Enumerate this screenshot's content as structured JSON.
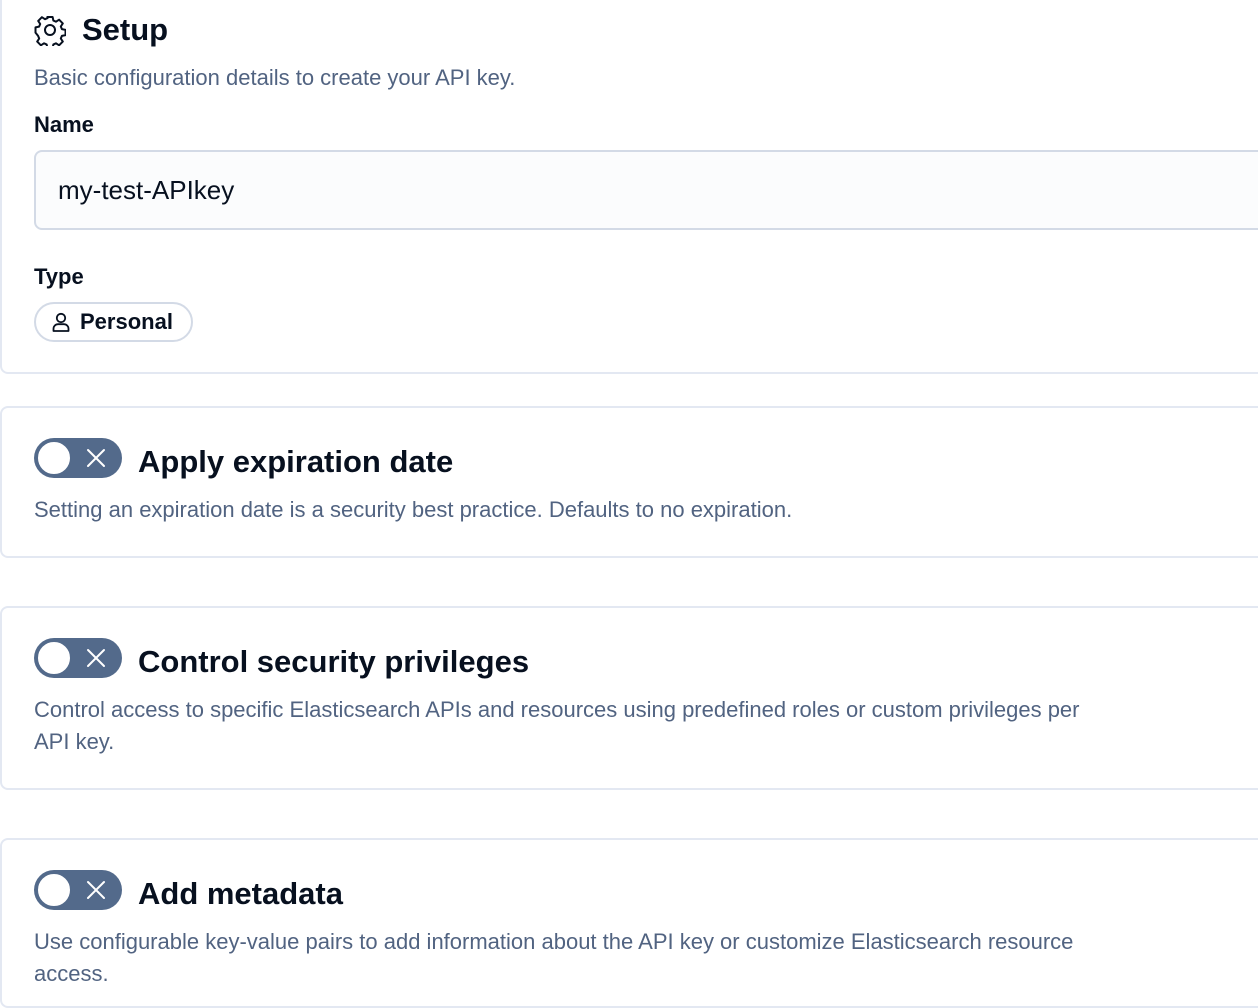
{
  "setup": {
    "icon": "gear-icon",
    "title": "Setup",
    "description": "Basic configuration details to create your API key.",
    "name_label": "Name",
    "name_value": "my-test-APIkey",
    "type_label": "Type",
    "type_icon": "user-icon",
    "type_value": "Personal"
  },
  "expiration": {
    "toggle_state": "off",
    "title": "Apply expiration date",
    "description": "Setting an expiration date is a security best practice. Defaults to no expiration."
  },
  "privileges": {
    "toggle_state": "off",
    "title": "Control security privileges",
    "description_line1": "Control access to specific Elasticsearch APIs and resources using predefined roles or custom privileges per",
    "description_line2": "API key."
  },
  "metadata": {
    "toggle_state": "off",
    "title": "Add metadata",
    "description_line1": "Use configurable key-value pairs to add information about the API key or customize Elasticsearch resource",
    "description_line2": "access."
  },
  "colors": {
    "text_primary": "#07101f",
    "text_subdued": "#516381",
    "toggle_off": "#536a8b",
    "border": "#d3dae6"
  }
}
